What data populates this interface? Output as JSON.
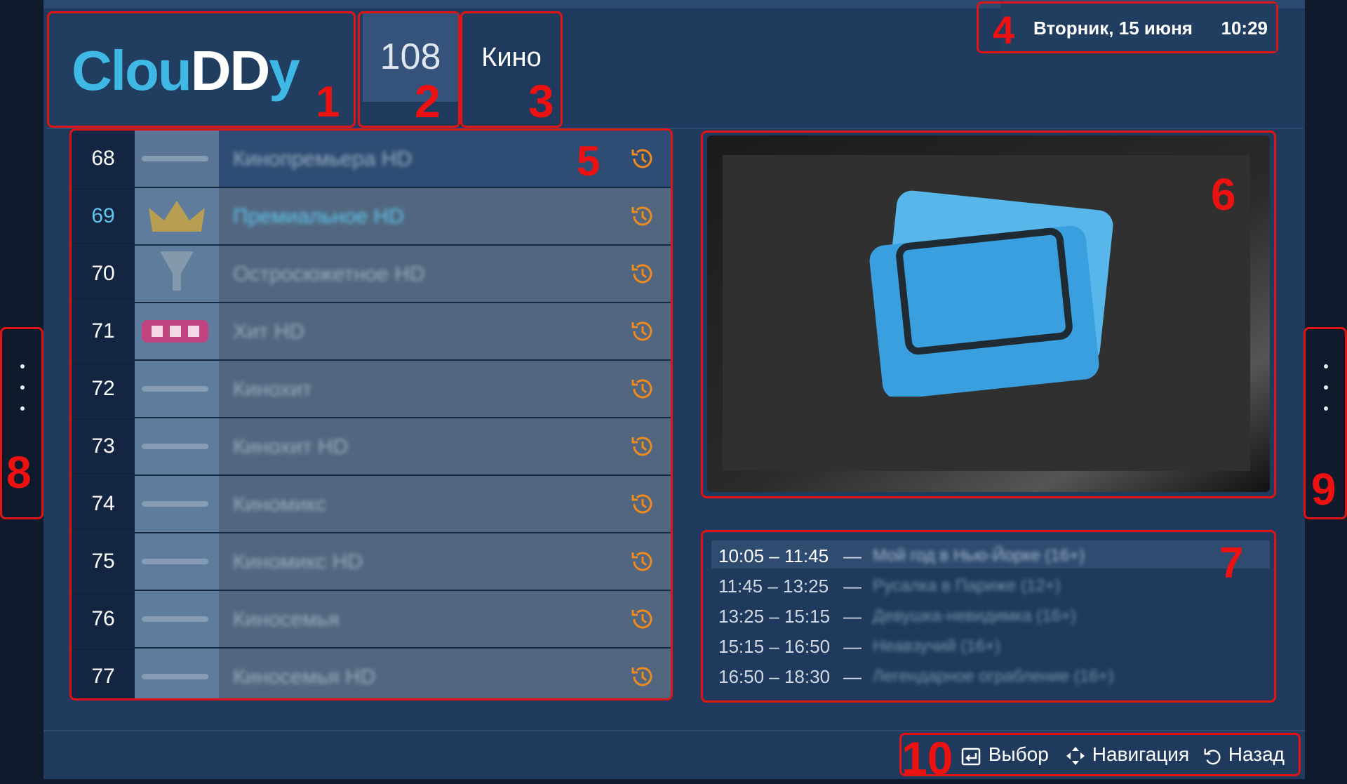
{
  "header": {
    "logo": {
      "part1": "Clou",
      "part2": "DD",
      "part3": "y"
    },
    "channel_count": "108",
    "category": "Кино",
    "date": "Вторник, 15 июня",
    "time": "10:29"
  },
  "annotations": {
    "n1": "1",
    "n2": "2",
    "n3": "3",
    "n4": "4",
    "n5": "5",
    "n6": "6",
    "n7": "7",
    "n8": "8",
    "n9": "9",
    "n10": "10"
  },
  "channels": [
    {
      "number": "68",
      "name": "Кинопремьера HD",
      "icon": "history-icon"
    },
    {
      "number": "69",
      "name": "Премиальное HD",
      "icon": "history-icon"
    },
    {
      "number": "70",
      "name": "Остросюжетное HD",
      "icon": "history-icon"
    },
    {
      "number": "71",
      "name": "Хит HD",
      "icon": "history-icon"
    },
    {
      "number": "72",
      "name": "Кинохит",
      "icon": "history-icon"
    },
    {
      "number": "73",
      "name": "Кинохит HD",
      "icon": "history-icon"
    },
    {
      "number": "74",
      "name": "Киномикс",
      "icon": "history-icon"
    },
    {
      "number": "75",
      "name": "Киномикс HD",
      "icon": "history-icon"
    },
    {
      "number": "76",
      "name": "Киносемья",
      "icon": "history-icon"
    },
    {
      "number": "77",
      "name": "Киносемья HD",
      "icon": "history-icon"
    }
  ],
  "schedule": [
    {
      "time": "10:05 – 11:45",
      "dash": "—",
      "title": "Мой год в Нью-Йорке (16+)"
    },
    {
      "time": "11:45 – 13:25",
      "dash": "—",
      "title": "Русалка в Париже (12+)"
    },
    {
      "time": "13:25 – 15:15",
      "dash": "—",
      "title": "Девушка-невидимка (16+)"
    },
    {
      "time": "15:15 – 16:50",
      "dash": "—",
      "title": "Неавзучий (16+)"
    },
    {
      "time": "16:50 – 18:30",
      "dash": "—",
      "title": "Легендарное ограбление (16+)"
    }
  ],
  "hints": {
    "select": "Выбор",
    "navigate": "Навигация",
    "back": "Назад"
  },
  "colors": {
    "accent": "#3fb8e6",
    "history_icon": "#f08a1c",
    "annotation": "#e01414"
  }
}
